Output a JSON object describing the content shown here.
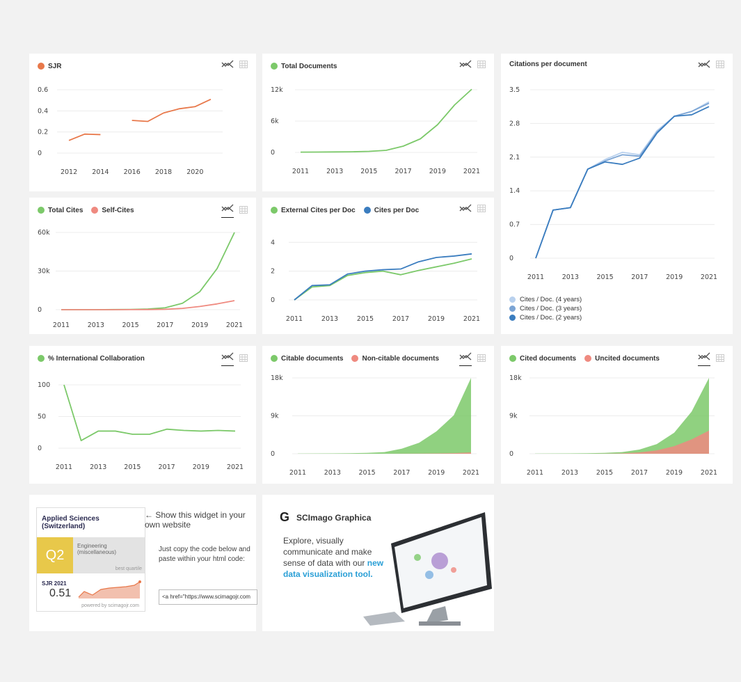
{
  "colors": {
    "orange": "#e8784a",
    "green": "#7cc96a",
    "red": "#ef8a80",
    "blue": "#3b7dbf",
    "blue2": "#7ba4d4",
    "blue3": "#b9d1ee",
    "grey": "#dddddd"
  },
  "icons": {
    "trend": "trend-icon",
    "table": "table-icon"
  },
  "charts": {
    "sjr": {
      "legend": [
        {
          "label": "SJR",
          "color": "#e8784a"
        }
      ],
      "xticks": [
        "2012",
        "2014",
        "2016",
        "2018",
        "2020"
      ],
      "yticks": [
        "0",
        "0.2",
        "0.4",
        "0.6"
      ]
    },
    "total_docs": {
      "legend": [
        {
          "label": "Total Documents",
          "color": "#7cc96a"
        }
      ],
      "xticks": [
        "2011",
        "2013",
        "2015",
        "2017",
        "2019",
        "2021"
      ],
      "yticks": [
        "0",
        "6k",
        "12k"
      ]
    },
    "citations": {
      "title": "Citations per document",
      "xticks": [
        "2011",
        "2013",
        "2015",
        "2017",
        "2019",
        "2021"
      ],
      "yticks": [
        "0",
        "0.7",
        "1.4",
        "2.1",
        "2.8",
        "3.5"
      ],
      "series_legend": [
        {
          "label": "Cites / Doc. (4 years)",
          "color": "#b9d1ee"
        },
        {
          "label": "Cites / Doc. (3 years)",
          "color": "#7ba4d4"
        },
        {
          "label": "Cites / Doc. (2 years)",
          "color": "#3b7dbf"
        }
      ]
    },
    "total_cites": {
      "legend": [
        {
          "label": "Total Cites",
          "color": "#7cc96a"
        },
        {
          "label": "Self-Cites",
          "color": "#ef8a80"
        }
      ],
      "xticks": [
        "2011",
        "2013",
        "2015",
        "2017",
        "2019",
        "2021"
      ],
      "yticks": [
        "0",
        "30k",
        "60k"
      ]
    },
    "ext_cites": {
      "legend": [
        {
          "label": "External Cites per Doc",
          "color": "#7cc96a"
        },
        {
          "label": "Cites per Doc",
          "color": "#3b7dbf"
        }
      ],
      "xticks": [
        "2011",
        "2013",
        "2015",
        "2017",
        "2019",
        "2021"
      ],
      "yticks": [
        "0",
        "2",
        "4"
      ]
    },
    "intl": {
      "legend": [
        {
          "label": "% International Collaboration",
          "color": "#7cc96a"
        }
      ],
      "xticks": [
        "2011",
        "2013",
        "2015",
        "2017",
        "2019",
        "2021"
      ],
      "yticks": [
        "0",
        "50",
        "100"
      ]
    },
    "citable": {
      "legend": [
        {
          "label": "Citable documents",
          "color": "#7cc96a"
        },
        {
          "label": "Non-citable documents",
          "color": "#ef8a80"
        }
      ],
      "xticks": [
        "2011",
        "2013",
        "2015",
        "2017",
        "2019",
        "2021"
      ],
      "yticks": [
        "0",
        "9k",
        "18k"
      ]
    },
    "cited": {
      "legend": [
        {
          "label": "Cited documents",
          "color": "#7cc96a"
        },
        {
          "label": "Uncited documents",
          "color": "#ef8a80"
        }
      ],
      "xticks": [
        "2011",
        "2013",
        "2015",
        "2017",
        "2019",
        "2021"
      ],
      "yticks": [
        "0",
        "9k",
        "18k"
      ]
    }
  },
  "widget": {
    "title": "Applied Sciences (Switzerland)",
    "quartile": "Q2",
    "category": "Engineering (miscellaneous)",
    "best_quartile": "best quartile",
    "sjr_label": "SJR 2021",
    "sjr_value": "0.51",
    "powered": "powered by scimagojr.com",
    "show_text": "← Show this widget in your own website",
    "copy_text": "Just copy the code below and paste within your html code:",
    "code": "<a href=\"https://www.scimagojr.com"
  },
  "graphica": {
    "logo": "G",
    "title": "SCImago Graphica",
    "text": "Explore, visually communicate and make sense of data with our",
    "link": "new data visualization tool."
  },
  "chart_data": [
    {
      "id": "sjr",
      "type": "line",
      "title": "",
      "x": [
        2012,
        2013,
        2014,
        2016,
        2017,
        2018,
        2019,
        2020,
        2021
      ],
      "series": [
        {
          "name": "SJR",
          "segments": [
            {
              "x": [
                2012,
                2013,
                2014
              ],
              "y": [
                0.12,
                0.18,
                0.175
              ]
            },
            {
              "x": [
                2016,
                2017,
                2018,
                2019,
                2020,
                2021
              ],
              "y": [
                0.31,
                0.3,
                0.38,
                0.42,
                0.44,
                0.51
              ]
            }
          ]
        }
      ],
      "xlim": [
        2011.6,
        2021.4
      ],
      "ylim": [
        0,
        0.6
      ]
    },
    {
      "id": "total_docs",
      "type": "line",
      "x": [
        2011,
        2012,
        2013,
        2014,
        2015,
        2016,
        2017,
        2018,
        2019,
        2020,
        2021
      ],
      "series": [
        {
          "name": "Total Documents",
          "y": [
            50,
            70,
            90,
            120,
            200,
            400,
            1200,
            2600,
            5300,
            9100,
            12100
          ]
        }
      ],
      "xlim": [
        2011,
        2021
      ],
      "ylim": [
        0,
        12000
      ]
    },
    {
      "id": "citations",
      "type": "line",
      "x": [
        2011,
        2012,
        2013,
        2014,
        2015,
        2016,
        2017,
        2018,
        2019,
        2020,
        2021
      ],
      "series": [
        {
          "name": "Cites / Doc. (4 years)",
          "y": [
            0,
            1.0,
            1.05,
            1.85,
            2.05,
            2.2,
            2.15,
            2.65,
            2.95,
            3.05,
            3.25
          ]
        },
        {
          "name": "Cites / Doc. (3 years)",
          "y": [
            0,
            1.0,
            1.05,
            1.85,
            2.02,
            2.15,
            2.12,
            2.62,
            2.95,
            3.05,
            3.22
          ]
        },
        {
          "name": "Cites / Doc. (2 years)",
          "y": [
            0,
            1.0,
            1.05,
            1.85,
            2.0,
            1.95,
            2.08,
            2.6,
            2.95,
            2.98,
            3.15
          ]
        }
      ],
      "xlim": [
        2011,
        2021
      ],
      "ylim": [
        0,
        3.5
      ]
    },
    {
      "id": "total_cites",
      "type": "line",
      "x": [
        2011,
        2012,
        2013,
        2014,
        2015,
        2016,
        2017,
        2018,
        2019,
        2020,
        2021
      ],
      "series": [
        {
          "name": "Total Cites",
          "y": [
            0,
            0,
            0,
            100,
            200,
            500,
            1500,
            5000,
            14000,
            32000,
            60000
          ]
        },
        {
          "name": "Self-Cites",
          "y": [
            0,
            0,
            0,
            0,
            50,
            100,
            300,
            1000,
            2500,
            4500,
            7000
          ]
        }
      ],
      "xlim": [
        2011,
        2021
      ],
      "ylim": [
        0,
        60000
      ]
    },
    {
      "id": "ext_cites",
      "type": "line",
      "x": [
        2011,
        2012,
        2013,
        2014,
        2015,
        2016,
        2017,
        2018,
        2019,
        2020,
        2021
      ],
      "series": [
        {
          "name": "External Cites per Doc",
          "y": [
            0,
            0.9,
            1.0,
            1.7,
            1.9,
            2.0,
            1.75,
            2.05,
            2.3,
            2.55,
            2.85
          ]
        },
        {
          "name": "Cites per Doc",
          "y": [
            0,
            1.0,
            1.05,
            1.8,
            2.0,
            2.1,
            2.15,
            2.65,
            2.95,
            3.05,
            3.2
          ]
        }
      ],
      "xlim": [
        2011,
        2021
      ],
      "ylim": [
        0,
        4.4
      ]
    },
    {
      "id": "intl",
      "type": "line",
      "x": [
        2011,
        2012,
        2013,
        2014,
        2015,
        2016,
        2017,
        2018,
        2019,
        2020,
        2021
      ],
      "series": [
        {
          "name": "% International Collaboration",
          "y": [
            100,
            12,
            27,
            27,
            22,
            22,
            30,
            28,
            27,
            28,
            27
          ]
        }
      ],
      "xlim": [
        2011,
        2021
      ],
      "ylim": [
        0,
        100
      ]
    },
    {
      "id": "citable",
      "type": "area",
      "x": [
        2011,
        2012,
        2013,
        2014,
        2015,
        2016,
        2017,
        2018,
        2019,
        2020,
        2021
      ],
      "series": [
        {
          "name": "Citable documents",
          "y": [
            50,
            70,
            90,
            120,
            200,
            400,
            1200,
            2600,
            5300,
            9100,
            18000
          ]
        },
        {
          "name": "Non-citable documents",
          "y": [
            0,
            0,
            0,
            0,
            5,
            10,
            20,
            40,
            80,
            150,
            300
          ]
        }
      ],
      "xlim": [
        2011,
        2021
      ],
      "ylim": [
        0,
        18000
      ]
    },
    {
      "id": "cited",
      "type": "area",
      "x": [
        2011,
        2012,
        2013,
        2014,
        2015,
        2016,
        2017,
        2018,
        2019,
        2020,
        2021
      ],
      "series": [
        {
          "name": "Cited documents",
          "y": [
            50,
            70,
            90,
            120,
            200,
            400,
            1000,
            2300,
            5000,
            10000,
            18000
          ]
        },
        {
          "name": "Uncited documents",
          "y": [
            0,
            0,
            0,
            10,
            30,
            80,
            300,
            800,
            1800,
            3400,
            5500
          ]
        }
      ],
      "xlim": [
        2011,
        2021
      ],
      "ylim": [
        0,
        18000
      ]
    }
  ]
}
